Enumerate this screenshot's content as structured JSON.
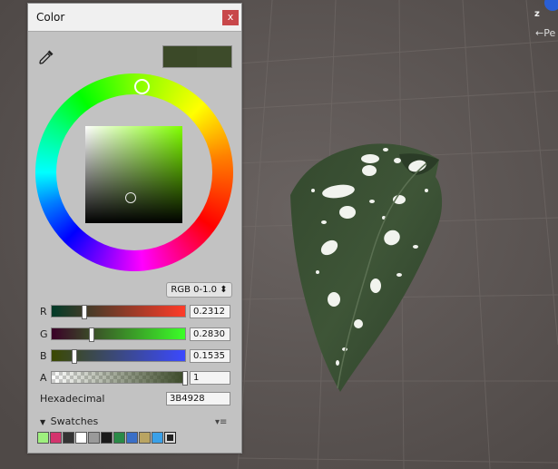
{
  "window": {
    "title": "Color",
    "close_label": "x"
  },
  "preview": {
    "current_color": "#3b4928"
  },
  "mode": {
    "label": "RGB 0-1.0 ⬍"
  },
  "channels": [
    {
      "label": "R",
      "value": "0.2312",
      "fraction": 0.2312
    },
    {
      "label": "G",
      "value": "0.2830",
      "fraction": 0.283
    },
    {
      "label": "B",
      "value": "0.1535",
      "fraction": 0.1535
    },
    {
      "label": "A",
      "value": "1",
      "fraction": 1.0
    }
  ],
  "hex": {
    "label": "Hexadecimal",
    "value": "3B4928"
  },
  "swatches": {
    "label": "Swatches",
    "colors": [
      "#9ef07e",
      "#d3336d",
      "#333333",
      "#ffffff",
      "#9a9a9a",
      "#1a1a1a",
      "#2a8a47",
      "#3a6fc8",
      "#b9a462",
      "#3aa0e8"
    ]
  },
  "scene": {
    "gizmo_axis": "z",
    "view_label": "←Pe"
  }
}
